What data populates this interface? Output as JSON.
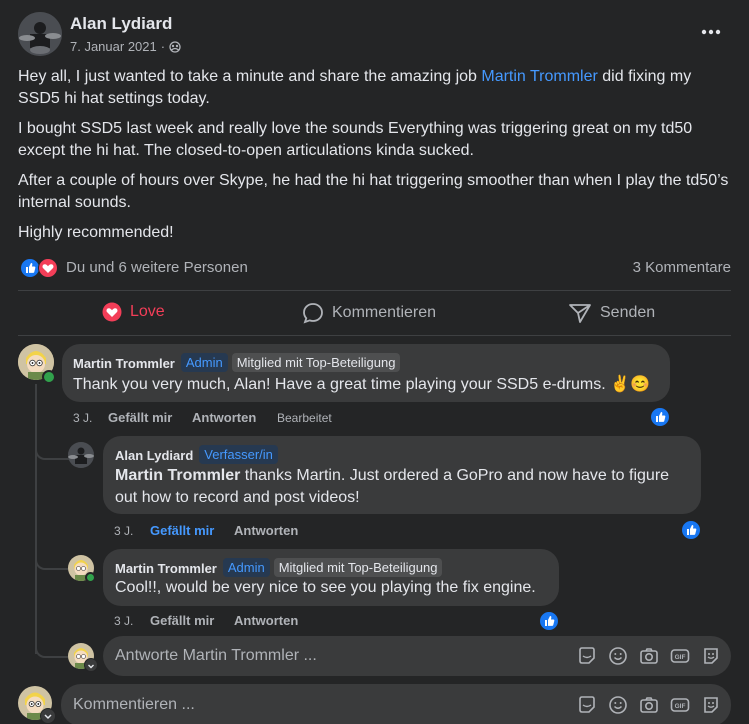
{
  "post": {
    "author": "Alan Lydiard",
    "date": "7. Januar 2021",
    "date_separator": "·",
    "paragraphs": {
      "p1_before": "Hey all, I just wanted to take a minute and share the amazing job ",
      "p1_link": "Martin Trommler",
      "p1_after": " did fixing my SSD5 hi hat settings today.",
      "p2": "I bought SSD5 last week and really love the sounds Everything was triggering great on my td50 except the hi hat. The closed-to-open articulations kinda sucked.",
      "p3": "After a couple of hours over Skype, he had the hi hat triggering smoother than when I play the td50’s internal sounds.",
      "p4": "Highly recommended!"
    },
    "reactions_text": "Du und 6 weitere Personen",
    "comments_count": "3 Kommentare",
    "actions": {
      "love": "Love",
      "comment": "Kommentieren",
      "send": "Senden"
    }
  },
  "comments": [
    {
      "author": "Martin Trommler",
      "badge_role": "Admin",
      "badge_member": "Mitglied mit Top-Beteiligung",
      "text": "Thank you very much, Alan! Have a great time playing your SSD5 e-drums. ✌😊",
      "time": "3 J.",
      "like": "Gefällt mir",
      "reply": "Antworten",
      "edited": "Bearbeitet"
    },
    {
      "author": "Alan Lydiard",
      "badge_role": "Verfasser/in",
      "mention": "Martin Trommler",
      "text": " thanks Martin. Just ordered a GoPro and now have to figure out how to record and post videos!",
      "time": "3 J.",
      "like": "Gefällt mir",
      "reply": "Antworten"
    },
    {
      "author": "Martin Trommler",
      "badge_role": "Admin",
      "badge_member": "Mitglied mit Top-Beteiligung",
      "text": "Cool!!, would be very nice to see you playing the fix engine.",
      "time": "3 J.",
      "like": "Gefällt mir",
      "reply": "Antworten"
    }
  ],
  "reply_input": {
    "placeholder": "Antworte Martin Trommler ..."
  },
  "comment_input": {
    "placeholder": "Kommentieren ..."
  },
  "colors": {
    "background": "#242526",
    "bubble": "#3a3b3c",
    "link": "#4599ff",
    "like_blue": "#1877f2",
    "love_red": "#f33e58"
  }
}
